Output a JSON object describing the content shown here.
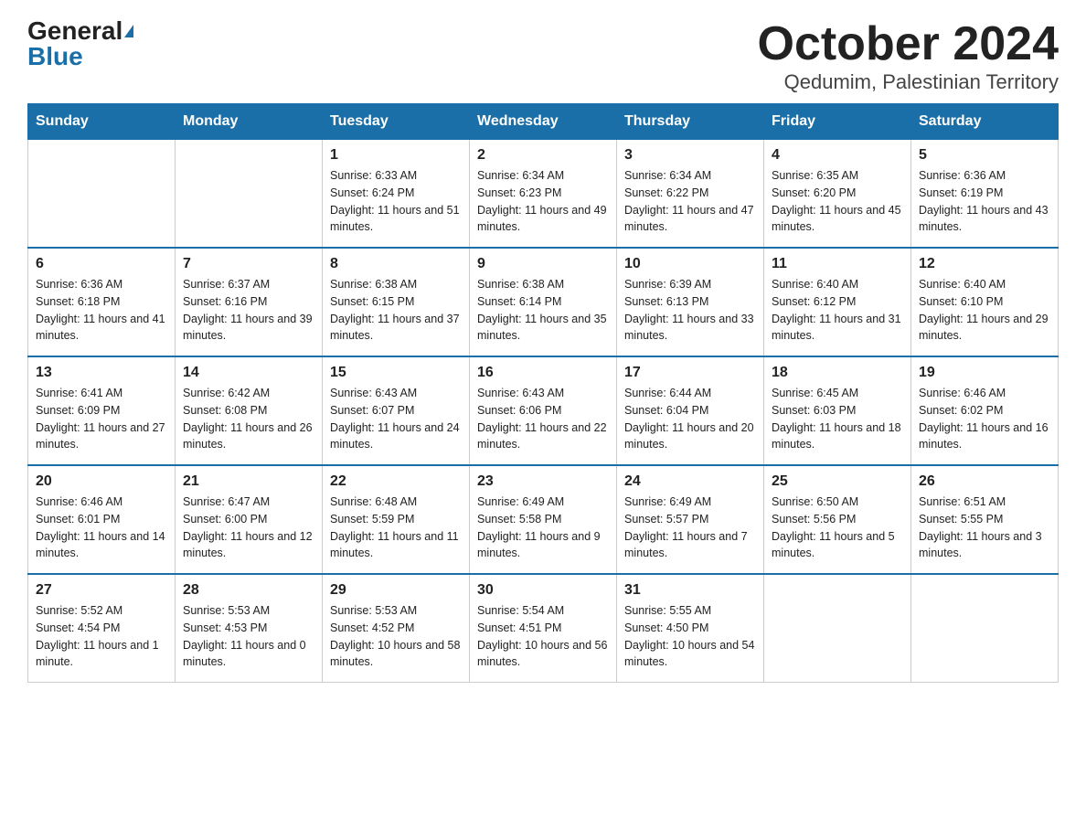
{
  "header": {
    "logo_general": "General",
    "logo_blue": "Blue",
    "title": "October 2024",
    "subtitle": "Qedumim, Palestinian Territory"
  },
  "days_of_week": [
    "Sunday",
    "Monday",
    "Tuesday",
    "Wednesday",
    "Thursday",
    "Friday",
    "Saturday"
  ],
  "weeks": [
    [
      {
        "num": "",
        "sunrise": "",
        "sunset": "",
        "daylight": ""
      },
      {
        "num": "",
        "sunrise": "",
        "sunset": "",
        "daylight": ""
      },
      {
        "num": "1",
        "sunrise": "Sunrise: 6:33 AM",
        "sunset": "Sunset: 6:24 PM",
        "daylight": "Daylight: 11 hours and 51 minutes."
      },
      {
        "num": "2",
        "sunrise": "Sunrise: 6:34 AM",
        "sunset": "Sunset: 6:23 PM",
        "daylight": "Daylight: 11 hours and 49 minutes."
      },
      {
        "num": "3",
        "sunrise": "Sunrise: 6:34 AM",
        "sunset": "Sunset: 6:22 PM",
        "daylight": "Daylight: 11 hours and 47 minutes."
      },
      {
        "num": "4",
        "sunrise": "Sunrise: 6:35 AM",
        "sunset": "Sunset: 6:20 PM",
        "daylight": "Daylight: 11 hours and 45 minutes."
      },
      {
        "num": "5",
        "sunrise": "Sunrise: 6:36 AM",
        "sunset": "Sunset: 6:19 PM",
        "daylight": "Daylight: 11 hours and 43 minutes."
      }
    ],
    [
      {
        "num": "6",
        "sunrise": "Sunrise: 6:36 AM",
        "sunset": "Sunset: 6:18 PM",
        "daylight": "Daylight: 11 hours and 41 minutes."
      },
      {
        "num": "7",
        "sunrise": "Sunrise: 6:37 AM",
        "sunset": "Sunset: 6:16 PM",
        "daylight": "Daylight: 11 hours and 39 minutes."
      },
      {
        "num": "8",
        "sunrise": "Sunrise: 6:38 AM",
        "sunset": "Sunset: 6:15 PM",
        "daylight": "Daylight: 11 hours and 37 minutes."
      },
      {
        "num": "9",
        "sunrise": "Sunrise: 6:38 AM",
        "sunset": "Sunset: 6:14 PM",
        "daylight": "Daylight: 11 hours and 35 minutes."
      },
      {
        "num": "10",
        "sunrise": "Sunrise: 6:39 AM",
        "sunset": "Sunset: 6:13 PM",
        "daylight": "Daylight: 11 hours and 33 minutes."
      },
      {
        "num": "11",
        "sunrise": "Sunrise: 6:40 AM",
        "sunset": "Sunset: 6:12 PM",
        "daylight": "Daylight: 11 hours and 31 minutes."
      },
      {
        "num": "12",
        "sunrise": "Sunrise: 6:40 AM",
        "sunset": "Sunset: 6:10 PM",
        "daylight": "Daylight: 11 hours and 29 minutes."
      }
    ],
    [
      {
        "num": "13",
        "sunrise": "Sunrise: 6:41 AM",
        "sunset": "Sunset: 6:09 PM",
        "daylight": "Daylight: 11 hours and 27 minutes."
      },
      {
        "num": "14",
        "sunrise": "Sunrise: 6:42 AM",
        "sunset": "Sunset: 6:08 PM",
        "daylight": "Daylight: 11 hours and 26 minutes."
      },
      {
        "num": "15",
        "sunrise": "Sunrise: 6:43 AM",
        "sunset": "Sunset: 6:07 PM",
        "daylight": "Daylight: 11 hours and 24 minutes."
      },
      {
        "num": "16",
        "sunrise": "Sunrise: 6:43 AM",
        "sunset": "Sunset: 6:06 PM",
        "daylight": "Daylight: 11 hours and 22 minutes."
      },
      {
        "num": "17",
        "sunrise": "Sunrise: 6:44 AM",
        "sunset": "Sunset: 6:04 PM",
        "daylight": "Daylight: 11 hours and 20 minutes."
      },
      {
        "num": "18",
        "sunrise": "Sunrise: 6:45 AM",
        "sunset": "Sunset: 6:03 PM",
        "daylight": "Daylight: 11 hours and 18 minutes."
      },
      {
        "num": "19",
        "sunrise": "Sunrise: 6:46 AM",
        "sunset": "Sunset: 6:02 PM",
        "daylight": "Daylight: 11 hours and 16 minutes."
      }
    ],
    [
      {
        "num": "20",
        "sunrise": "Sunrise: 6:46 AM",
        "sunset": "Sunset: 6:01 PM",
        "daylight": "Daylight: 11 hours and 14 minutes."
      },
      {
        "num": "21",
        "sunrise": "Sunrise: 6:47 AM",
        "sunset": "Sunset: 6:00 PM",
        "daylight": "Daylight: 11 hours and 12 minutes."
      },
      {
        "num": "22",
        "sunrise": "Sunrise: 6:48 AM",
        "sunset": "Sunset: 5:59 PM",
        "daylight": "Daylight: 11 hours and 11 minutes."
      },
      {
        "num": "23",
        "sunrise": "Sunrise: 6:49 AM",
        "sunset": "Sunset: 5:58 PM",
        "daylight": "Daylight: 11 hours and 9 minutes."
      },
      {
        "num": "24",
        "sunrise": "Sunrise: 6:49 AM",
        "sunset": "Sunset: 5:57 PM",
        "daylight": "Daylight: 11 hours and 7 minutes."
      },
      {
        "num": "25",
        "sunrise": "Sunrise: 6:50 AM",
        "sunset": "Sunset: 5:56 PM",
        "daylight": "Daylight: 11 hours and 5 minutes."
      },
      {
        "num": "26",
        "sunrise": "Sunrise: 6:51 AM",
        "sunset": "Sunset: 5:55 PM",
        "daylight": "Daylight: 11 hours and 3 minutes."
      }
    ],
    [
      {
        "num": "27",
        "sunrise": "Sunrise: 5:52 AM",
        "sunset": "Sunset: 4:54 PM",
        "daylight": "Daylight: 11 hours and 1 minute."
      },
      {
        "num": "28",
        "sunrise": "Sunrise: 5:53 AM",
        "sunset": "Sunset: 4:53 PM",
        "daylight": "Daylight: 11 hours and 0 minutes."
      },
      {
        "num": "29",
        "sunrise": "Sunrise: 5:53 AM",
        "sunset": "Sunset: 4:52 PM",
        "daylight": "Daylight: 10 hours and 58 minutes."
      },
      {
        "num": "30",
        "sunrise": "Sunrise: 5:54 AM",
        "sunset": "Sunset: 4:51 PM",
        "daylight": "Daylight: 10 hours and 56 minutes."
      },
      {
        "num": "31",
        "sunrise": "Sunrise: 5:55 AM",
        "sunset": "Sunset: 4:50 PM",
        "daylight": "Daylight: 10 hours and 54 minutes."
      },
      {
        "num": "",
        "sunrise": "",
        "sunset": "",
        "daylight": ""
      },
      {
        "num": "",
        "sunrise": "",
        "sunset": "",
        "daylight": ""
      }
    ]
  ]
}
